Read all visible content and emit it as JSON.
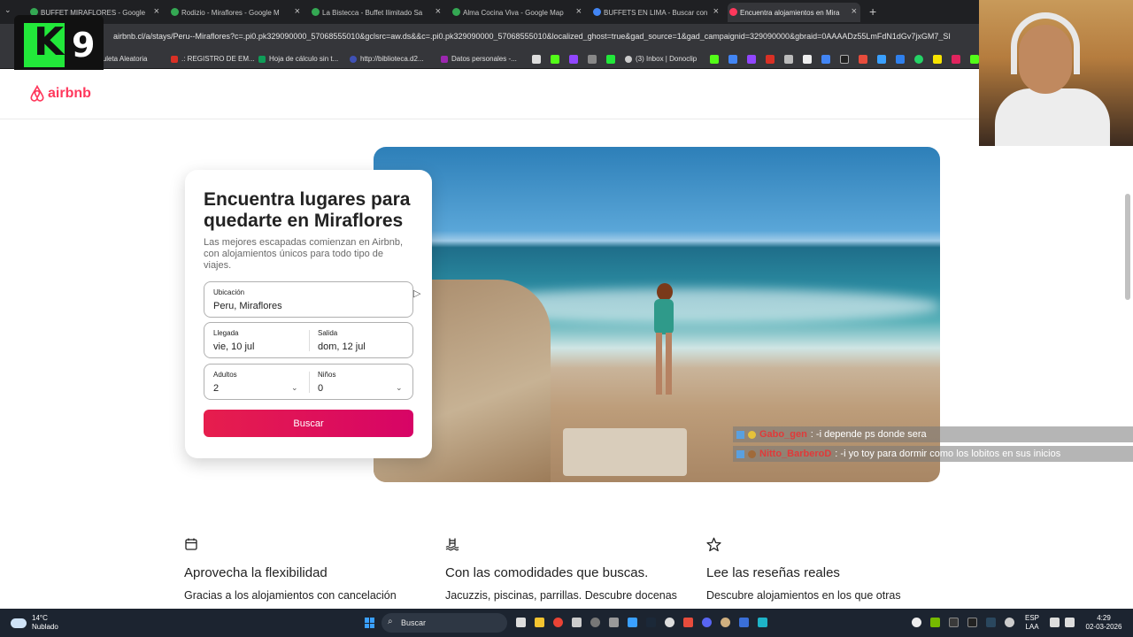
{
  "browser": {
    "tabs": [
      {
        "label": "BUFFET MIRAFLORES - Google M",
        "favicon_color": "#34a853"
      },
      {
        "label": "Rodizio - Miraflores - Google M",
        "favicon_color": "#34a853"
      },
      {
        "label": "La Bistecca - Buffet Ilimitado Sa",
        "favicon_color": "#34a853"
      },
      {
        "label": "Alma Cocina Viva - Google Map",
        "favicon_color": "#34a853"
      },
      {
        "label": "BUFFETS EN LIMA - Buscar con",
        "favicon_color": "#4285f4"
      },
      {
        "label": "Encuentra alojamientos en Mira",
        "favicon_color": "#ff385c"
      }
    ],
    "new_tab": "+",
    "url": "airbnb.cl/a/stays/Peru--Miraflores?c=.pi0.pk329090000_57068555010&gclsrc=aw.ds&&c=.pi0.pk329090000_57068555010&localized_ghost=true&gad_source=1&gad_campaignid=329090000&gbraid=0AAAADz55LmFdN1dGv7jxGM7_SI",
    "bookmarks": [
      {
        "label": "Ruleta Aleatoria",
        "color": "#f4b400"
      },
      {
        "label": ".: REGISTRO DE EM...",
        "color": "#d93025"
      },
      {
        "label": "Hoja de cálculo sin t...",
        "color": "#0f9d58"
      },
      {
        "label": "http://biblioteca.d2...",
        "color": "#3f51b5"
      },
      {
        "label": "Datos personales -...",
        "color": "#9c27b0"
      },
      {
        "label": "(3) Inbox | Donoclip",
        "color": "#cccccc"
      }
    ]
  },
  "overlay": {
    "k9_letter": "K",
    "k9_number": "9"
  },
  "airbnb": {
    "logo_text": "airbnb",
    "brand_color": "#ff385c",
    "hero": {
      "title": "Encuentra lugares para quedarte en Miraflores",
      "subtitle": "Las mejores escapadas comienzan en Airbnb, con alojamientos únicos para todo tipo de viajes."
    },
    "form": {
      "location_label": "Ubicación",
      "location_value": "Peru, Miraflores",
      "checkin_label": "Llegada",
      "checkin_value": "vie, 10 jul",
      "checkout_label": "Salida",
      "checkout_value": "dom, 12 jul",
      "adults_label": "Adultos",
      "adults_value": "2",
      "children_label": "Niños",
      "children_value": "0",
      "search_button": "Buscar"
    },
    "features": [
      {
        "icon": "calendar-icon",
        "title": "Aprovecha la flexibilidad",
        "text": "Gracias a los alojamientos con cancelación"
      },
      {
        "icon": "pool-icon",
        "title": "Con las comodidades que buscas.",
        "text": "Jacuzzis, piscinas, parrillas. Descubre docenas"
      },
      {
        "icon": "star-icon",
        "title": "Lee las reseñas reales",
        "text": "Descubre alojamientos en los que otras"
      }
    ]
  },
  "chat": [
    {
      "user": "Gabo_gen",
      "message": ": -i depende ps donde sera"
    },
    {
      "user": "Nitto_BarberoD",
      "message": ": -i yo toy para dormir como los lobitos en sus inicios"
    }
  ],
  "taskbar": {
    "weather_temp": "14°C",
    "weather_desc": "Nublado",
    "search_placeholder": "Buscar",
    "lang_top": "ESP",
    "lang_bottom": "LAA",
    "time": "4:29",
    "date": "02-03-2026"
  }
}
